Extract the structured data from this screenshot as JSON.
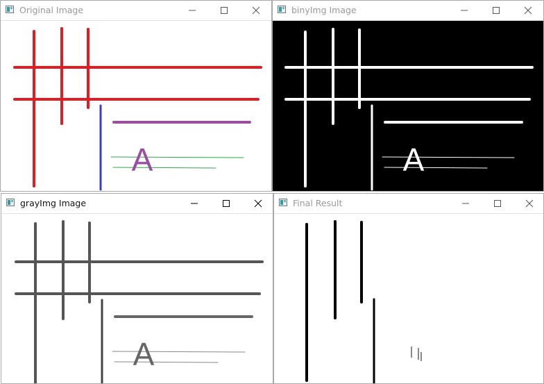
{
  "windows": {
    "original": {
      "title": "Original Image",
      "glyph": "A",
      "colors": {
        "red": "#e31b23",
        "blue": "#3c3cc6",
        "purple": "#9b4da0",
        "green": "#2dab46"
      }
    },
    "binary": {
      "title": "binyImg Image",
      "glyph": "A"
    },
    "gray": {
      "title": "grayImg Image",
      "glyph": "A"
    },
    "final": {
      "title": "Final Result"
    }
  },
  "controls": [
    "minimize-icon",
    "maximize-icon",
    "close-icon"
  ]
}
